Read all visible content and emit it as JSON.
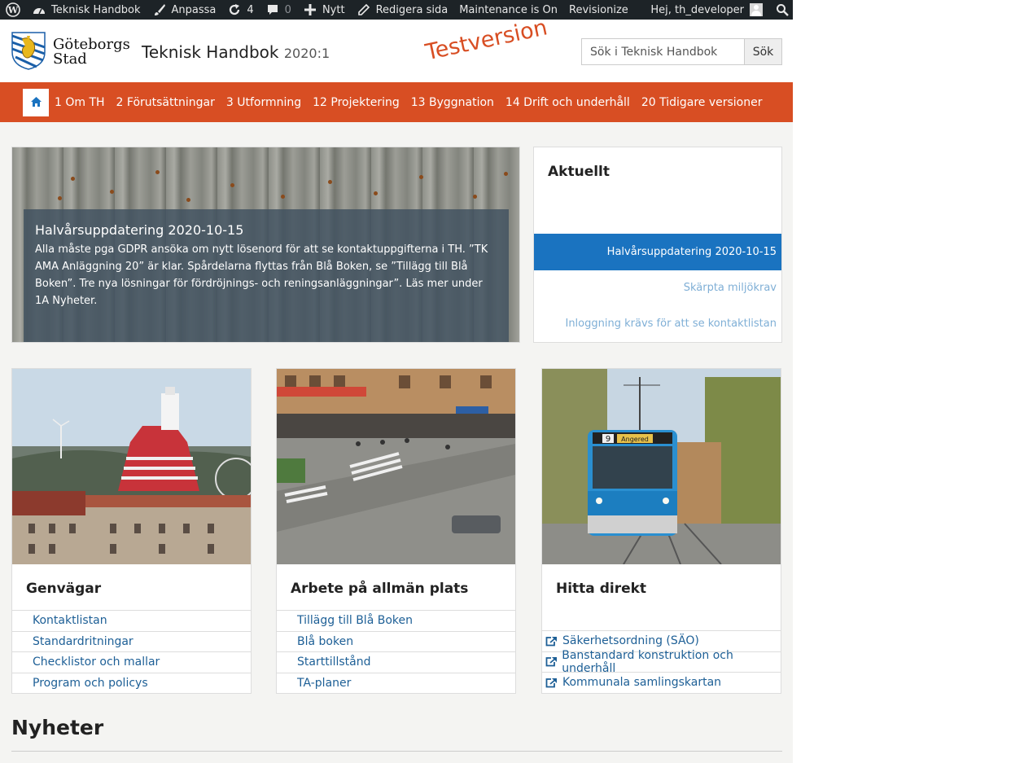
{
  "adminbar": {
    "site_name": "Teknisk Handbok",
    "customize": "Anpassa",
    "updates_count": "4",
    "comments_count": "0",
    "new": "Nytt",
    "edit_page": "Redigera sida",
    "maintenance": "Maintenance is On",
    "revisionize": "Revisionize",
    "greeting": "Hej, th_developer"
  },
  "header": {
    "logo_line1": "Göteborgs",
    "logo_line2": "Stad",
    "title": "Teknisk Handbok",
    "version": "2020:1",
    "stamp": "Testversion",
    "search_placeholder": "Sök i Teknisk Handbok",
    "search_button": "Sök"
  },
  "nav": {
    "items": [
      "1 Om TH",
      "2 Förutsättningar",
      "3 Utformning",
      "12 Projektering",
      "13 Byggnation",
      "14 Drift och underhåll",
      "20 Tidigare versioner"
    ]
  },
  "hero": {
    "title": "Halvårsuppdatering 2020-10-15",
    "text": "Alla måste pga GDPR ansöka om nytt lösenord för att se kontaktuppgifterna i TH. ”TK AMA Anläggning 20” är klar. Spårdelarna flyttas från Blå Boken, se ”Tillägg till Blå Boken”. Tre nya lösningar för fördröjnings- och reningsanläggningar”. Läs mer under 1A Nyheter."
  },
  "aktuellt": {
    "heading": "Aktuellt",
    "items": [
      "Halvårsuppdatering 2020-10-15",
      "Skärpta miljökrav",
      "Inloggning krävs för att se kontaktlistan"
    ],
    "active_color": "#1a73c0"
  },
  "cards": [
    {
      "heading": "Genvägar",
      "links": [
        "Kontaktlistan",
        "Standardritningar",
        "Checklistor och mallar",
        "Program och policys"
      ]
    },
    {
      "heading": "Arbete på allmän plats",
      "links": [
        "Tillägg till Blå Boken",
        "Blå boken",
        "Starttillstånd",
        "TA-planer"
      ]
    },
    {
      "heading": "Hitta direkt",
      "links": [
        "Säkerhetsordning (SÄO)",
        "Banstandard konstruktion och underhåll",
        "Kommunala samlingskartan"
      ]
    }
  ],
  "tram": {
    "number": "9",
    "destination": "Angered"
  },
  "news_heading": "Nyheter",
  "colors": {
    "nav": "#d84e23",
    "adminbar": "#1d2327",
    "link": "#1d5f96"
  }
}
